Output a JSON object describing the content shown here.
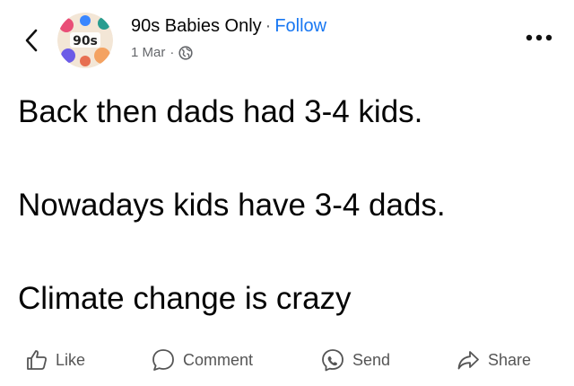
{
  "header": {
    "page_name": "90s Babies Only",
    "separator": "·",
    "follow_label": "Follow",
    "date": "1 Mar",
    "meta_separator": "·",
    "avatar_text": "90s",
    "back_icon": "chevron-left-icon",
    "privacy_icon": "globe-icon",
    "more_icon": "more-dots-icon"
  },
  "post": {
    "lines": [
      "Back then dads had 3-4 kids.",
      "Nowadays kids have 3-4 dads.",
      "Climate change is crazy"
    ]
  },
  "actions": {
    "like_label": "Like",
    "comment_label": "Comment",
    "send_label": "Send",
    "share_label": "Share"
  },
  "colors": {
    "follow": "#1877f2",
    "text": "#050505",
    "secondary": "#65676b"
  }
}
